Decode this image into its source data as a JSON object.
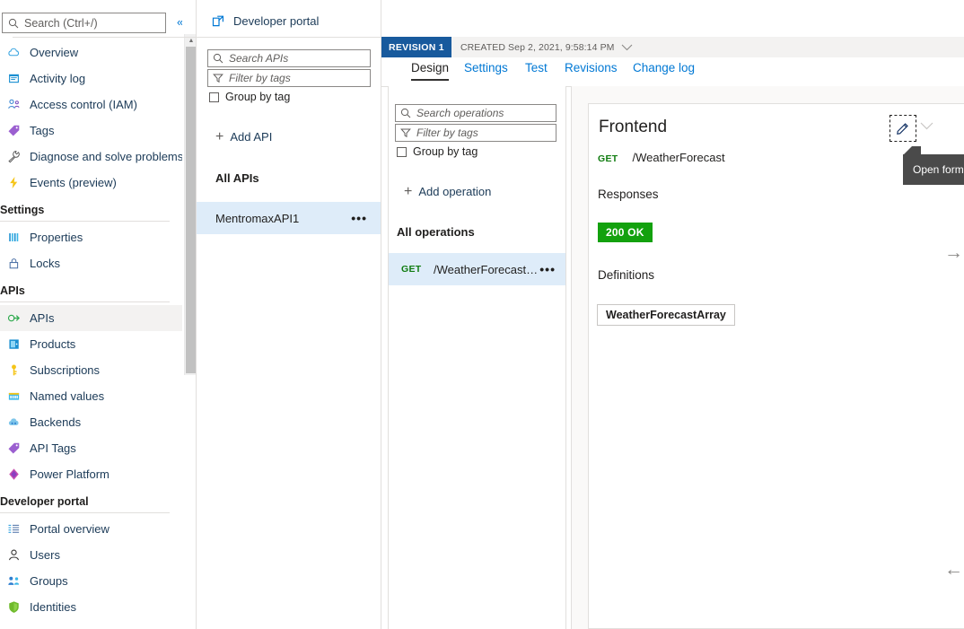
{
  "left_nav": {
    "search": {
      "placeholder": "Search (Ctrl+/)",
      "value": "",
      "icon": "search-icon"
    },
    "collapse_glyph": "«",
    "items": [
      {
        "label": "Overview",
        "icon": "cloud-icon",
        "type": "item",
        "selected": false
      },
      {
        "label": "Activity log",
        "icon": "activity-log-icon",
        "type": "item",
        "selected": false
      },
      {
        "label": "Access control (IAM)",
        "icon": "access-control-icon",
        "type": "item",
        "selected": false
      },
      {
        "label": "Tags",
        "icon": "tag-icon",
        "type": "item",
        "selected": false
      },
      {
        "label": "Diagnose and solve problems",
        "icon": "wrench-icon",
        "type": "item",
        "selected": false
      },
      {
        "label": "Events (preview)",
        "icon": "lightning-icon",
        "type": "item",
        "selected": false
      },
      {
        "label": "Settings",
        "type": "section"
      },
      {
        "label": "Properties",
        "icon": "properties-icon",
        "type": "item",
        "selected": false
      },
      {
        "label": "Locks",
        "icon": "lock-icon",
        "type": "item",
        "selected": false
      },
      {
        "label": "APIs",
        "type": "section"
      },
      {
        "label": "APIs",
        "icon": "apis-icon",
        "type": "item",
        "selected": true
      },
      {
        "label": "Products",
        "icon": "products-icon",
        "type": "item",
        "selected": false
      },
      {
        "label": "Subscriptions",
        "icon": "key-icon",
        "type": "item",
        "selected": false
      },
      {
        "label": "Named values",
        "icon": "named-values-icon",
        "type": "item",
        "selected": false
      },
      {
        "label": "Backends",
        "icon": "backends-icon",
        "type": "item",
        "selected": false
      },
      {
        "label": "API Tags",
        "icon": "api-tags-icon",
        "type": "item",
        "selected": false
      },
      {
        "label": "Power Platform",
        "icon": "power-platform-icon",
        "type": "item",
        "selected": false
      },
      {
        "label": "Developer portal",
        "type": "section"
      },
      {
        "label": "Portal overview",
        "icon": "portal-overview-icon",
        "type": "item",
        "selected": false
      },
      {
        "label": "Users",
        "icon": "user-icon",
        "type": "item",
        "selected": false
      },
      {
        "label": "Groups",
        "icon": "groups-icon",
        "type": "item",
        "selected": false
      },
      {
        "label": "Identities",
        "icon": "shield-icon",
        "type": "item",
        "selected": false
      }
    ]
  },
  "apis_column": {
    "developer_portal_link": {
      "label": "Developer portal",
      "icon": "external-link-icon"
    },
    "search": {
      "placeholder": "Search APIs",
      "value": "",
      "icon": "search-icon"
    },
    "filter": {
      "placeholder": "Filter by tags",
      "value": "",
      "icon": "filter-icon"
    },
    "group_by_tag": {
      "label": "Group by tag",
      "checked": false
    },
    "add_api": {
      "label": "Add API",
      "icon": "plus-icon"
    },
    "group_header": "All APIs",
    "items": [
      {
        "name": "MentromaxAPI1",
        "active": true,
        "overflow": "•••"
      }
    ]
  },
  "revision_bar": {
    "badge": "REVISION 1",
    "created_label": "CREATED Sep 2, 2021, 9:58:14 PM",
    "chevron": "⌵"
  },
  "tabs": [
    {
      "label": "Design",
      "active": true
    },
    {
      "label": "Settings",
      "active": false
    },
    {
      "label": "Test",
      "active": false
    },
    {
      "label": "Revisions",
      "active": false
    },
    {
      "label": "Change log",
      "active": false
    }
  ],
  "operations_column": {
    "search": {
      "placeholder": "Search operations",
      "value": "",
      "icon": "search-icon"
    },
    "filter": {
      "placeholder": "Filter by tags",
      "value": "",
      "icon": "filter-icon"
    },
    "group_by_tag": {
      "label": "Group by tag",
      "checked": false
    },
    "add_operation": {
      "label": "Add operation",
      "icon": "plus-icon"
    },
    "group_header": "All operations",
    "items": [
      {
        "verb": "GET",
        "path": "/WeatherForecast…",
        "active": true,
        "overflow": "•••"
      }
    ]
  },
  "detail": {
    "title": "Frontend",
    "edit_button": {
      "icon": "pencil-icon",
      "tooltip": "Open form-b"
    },
    "expand_chevron": "⌵",
    "endpoint": {
      "verb": "GET",
      "path": "/WeatherForecast"
    },
    "responses_label": "Responses",
    "status": {
      "label": "200 OK",
      "color": "#13a10e"
    },
    "definitions_label": "Definitions",
    "definition_chip": "WeatherForecastArray"
  },
  "edge_controls": {
    "right_arrow": "→",
    "left_arrow": "←"
  },
  "colors": {
    "accent": "#0078d4",
    "link": "#1b3a57",
    "selection": "#deecf9",
    "nav_selected": "#f3f2f1",
    "revision_badge": "#185a9d",
    "success": "#13a10e",
    "verb_get": "#107c10",
    "panel_bg": "#faf9f8",
    "border": "#e1dfdd"
  }
}
